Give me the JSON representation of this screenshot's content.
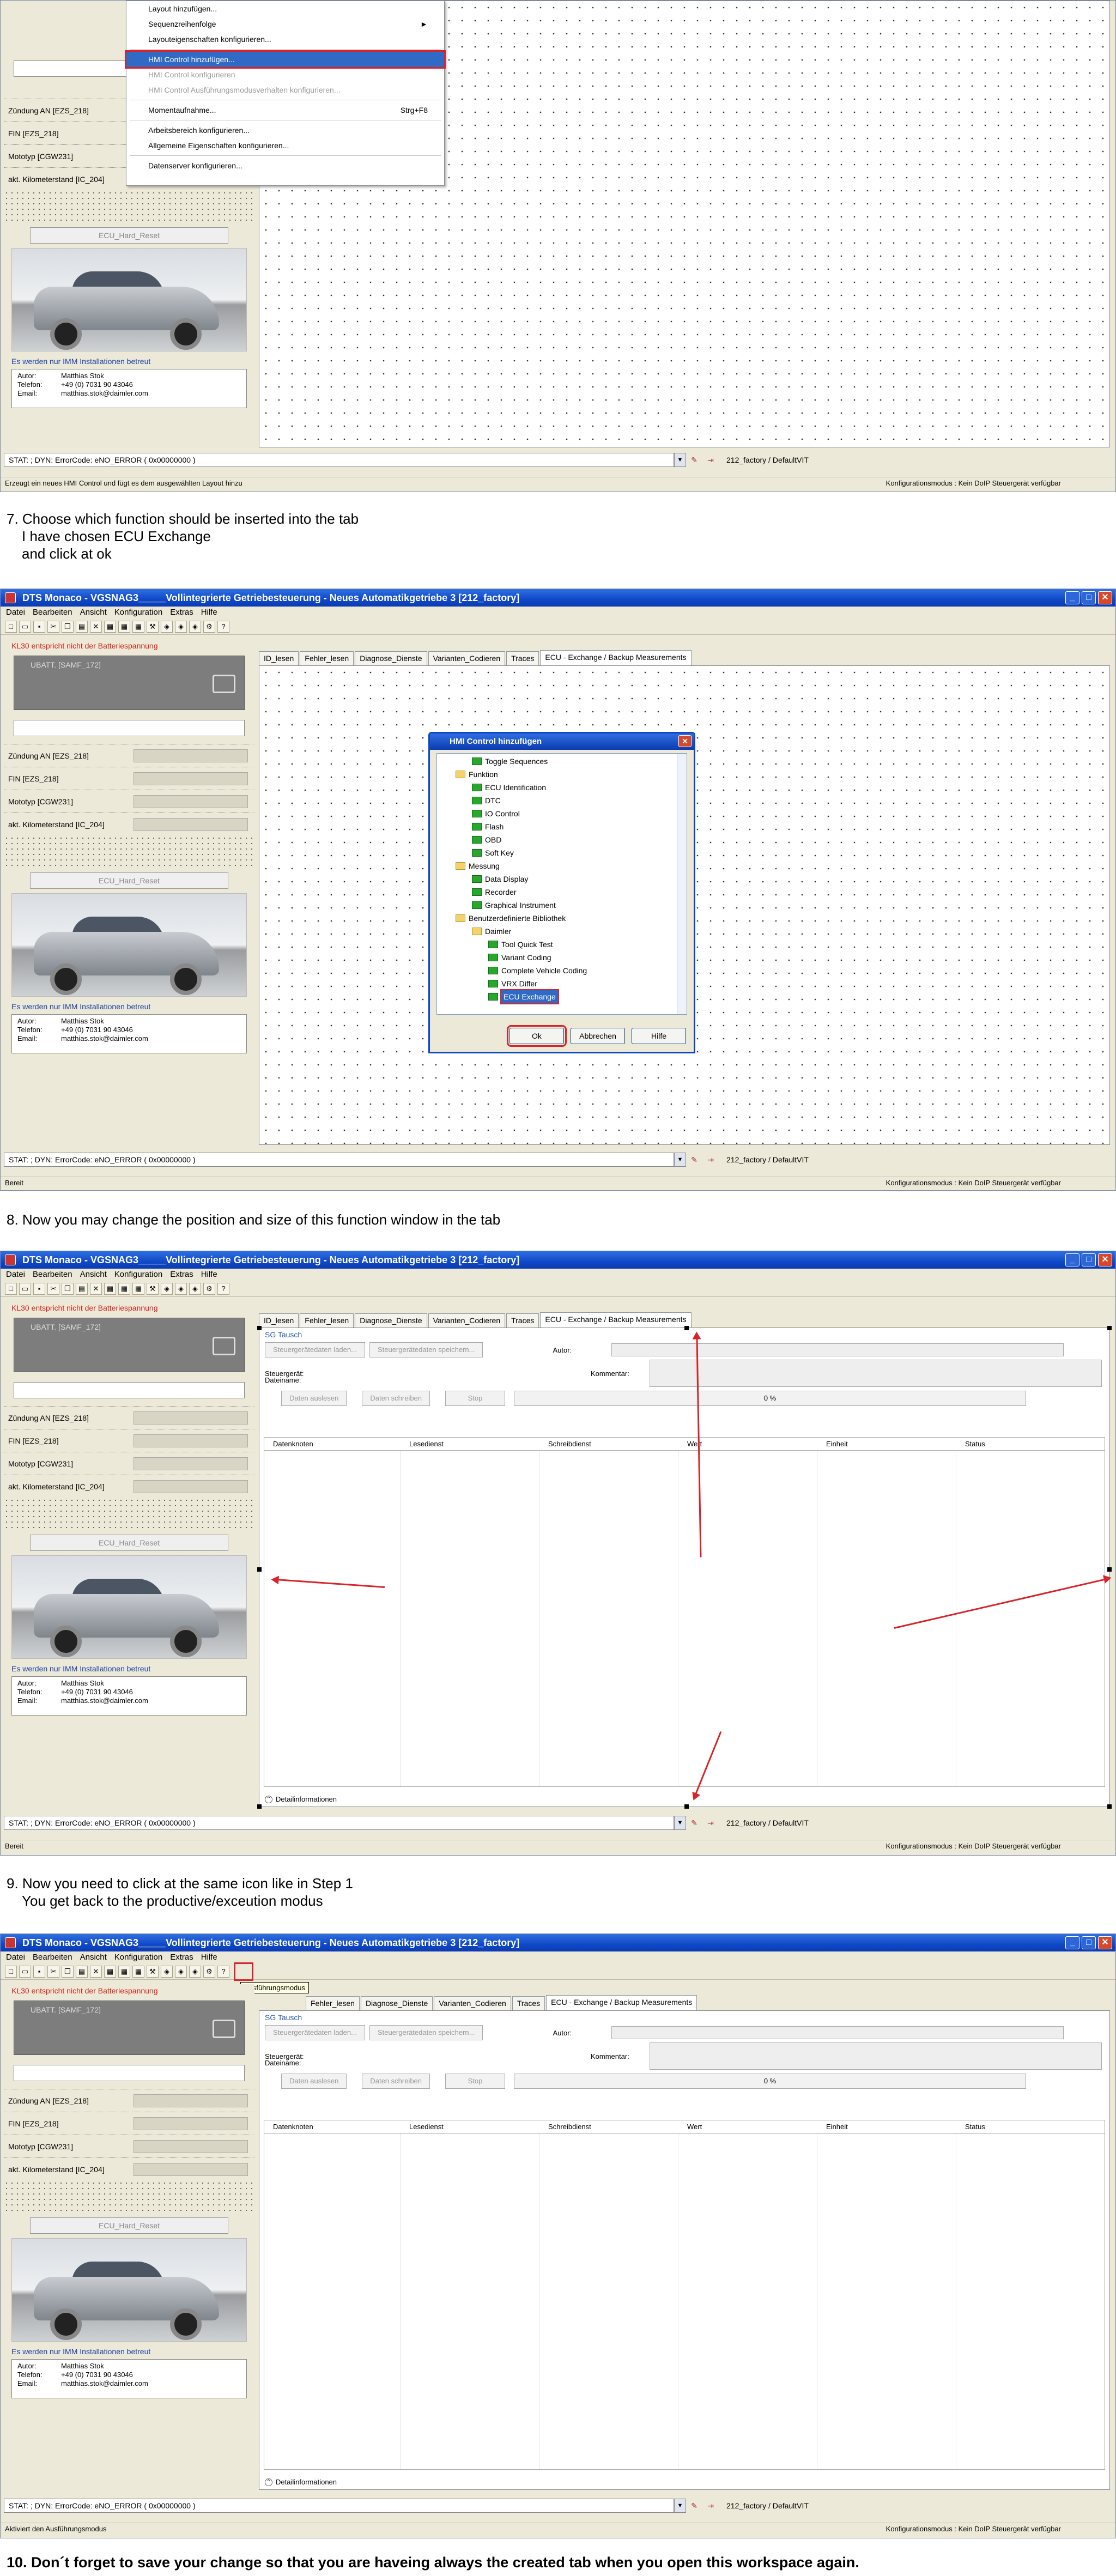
{
  "section1": {
    "menu_items": [
      {
        "label": "Layout hinzufügen...",
        "disabled": false
      },
      {
        "label": "Sequenzreihenfolge",
        "disabled": false,
        "submenu": true
      },
      {
        "label": "Layouteigenschaften konfigurieren...",
        "disabled": false
      },
      {
        "label": "HMI Control hinzufügen...",
        "disabled": false,
        "highlighted": true
      },
      {
        "label": "HMI Control konfigurieren",
        "disabled": true
      },
      {
        "label": "HMI Control Ausführungsmodusverhalten konfigurieren...",
        "disabled": true
      },
      {
        "label": "Momentaufnahme...",
        "disabled": false,
        "shortcut": "Strg+F8"
      },
      {
        "label": "Arbeitsbereich konfigurieren...",
        "disabled": false
      },
      {
        "label": "Allgemeine Eigenschaften konfigurieren...",
        "disabled": false
      },
      {
        "label": "Datenserver konfigurieren...",
        "disabled": false
      }
    ],
    "status_hint": "Erzeugt ein neues HMI Control und fügt es dem ausgewählten Layout hinzu"
  },
  "common": {
    "app_title": "DTS Monaco - VGSNAG3_____Vollintegrierte Getriebesteuerung - Neues Automatikgetriebe 3 [212_factory]",
    "menu": [
      "Datei",
      "Bearbeiten",
      "Ansicht",
      "Konfiguration",
      "Extras",
      "Hilfe"
    ],
    "tabs": [
      "ID_lesen",
      "Fehler_lesen",
      "Diagnose_Dienste",
      "Varianten_Codieren",
      "Traces",
      "ECU - Exchange / Backup Measurements"
    ],
    "warning": "KL30 entspricht nicht der Batteriespannung",
    "ubatt": "UBATT. [SAMF_172]",
    "rows": [
      "Zündung AN [EZS_218]",
      "FIN [EZS_218]",
      "Mototyp [CGW231]",
      "akt. Kilometerstand [IC_204]"
    ],
    "ecu_hard_reset": "ECU_Hard_Reset",
    "imm_note": "Es werden nur IMM Installationen betreut",
    "author": [
      {
        "k": "Autor:",
        "v": "Matthias Stok"
      },
      {
        "k": "Telefon:",
        "v": "+49 (0) 7031 90 43046"
      },
      {
        "k": "Email:",
        "v": "matthias.stok@daimler.com"
      }
    ],
    "stat": "STAT: ; DYN: ErrorCode: eNO_ERROR  ( 0x00000000 )",
    "config": "212_factory / DefaultVIT",
    "ready": "Bereit",
    "config_mode": "Konfigurationsmodus : Kein DoIP Steuergerät verfügbar"
  },
  "step7": {
    "line1": "7. Choose which function should be inserted into the tab",
    "line2": "I have chosen ECU Exchange",
    "line3": "and click at ok"
  },
  "dialog": {
    "title": "HMI Control hinzufügen",
    "tree": [
      {
        "label": "Toggle Sequences",
        "level": 2,
        "kind": "leaf"
      },
      {
        "label": "Funktion",
        "level": 1,
        "kind": "folder"
      },
      {
        "label": "ECU Identification",
        "level": 2,
        "kind": "leaf"
      },
      {
        "label": "DTC",
        "level": 2,
        "kind": "leaf"
      },
      {
        "label": "IO Control",
        "level": 2,
        "kind": "leaf"
      },
      {
        "label": "Flash",
        "level": 2,
        "kind": "leaf"
      },
      {
        "label": "OBD",
        "level": 2,
        "kind": "leaf"
      },
      {
        "label": "Soft Key",
        "level": 2,
        "kind": "leaf"
      },
      {
        "label": "Messung",
        "level": 1,
        "kind": "folder"
      },
      {
        "label": "Data Display",
        "level": 2,
        "kind": "leaf"
      },
      {
        "label": "Recorder",
        "level": 2,
        "kind": "leaf"
      },
      {
        "label": "Graphical Instrument",
        "level": 2,
        "kind": "leaf"
      },
      {
        "label": "Benutzerdefinierte Bibliothek",
        "level": 1,
        "kind": "folder"
      },
      {
        "label": "Daimler",
        "level": 2,
        "kind": "folder"
      },
      {
        "label": "Tool Quick Test",
        "level": 3,
        "kind": "leaf"
      },
      {
        "label": "Variant Coding",
        "level": 3,
        "kind": "leaf"
      },
      {
        "label": "Complete Vehicle Coding",
        "level": 3,
        "kind": "leaf"
      },
      {
        "label": "VRX Differ",
        "level": 3,
        "kind": "leaf"
      },
      {
        "label": "ECU Exchange",
        "level": 3,
        "kind": "leaf",
        "selected": true
      }
    ],
    "ok": "Ok",
    "cancel": "Abbrechen",
    "help": "Hilfe"
  },
  "step8": {
    "line1": "8. Now you may change the position and size of this function window in the tab"
  },
  "sg": {
    "title": "SG Tausch",
    "load": "Steuergerätedaten laden...",
    "save": "Steuergerätedaten speichern...",
    "author_lbl": "Autor:",
    "device_lbl": "Steuergerät:",
    "comment_lbl": "Kommentar:",
    "file_lbl": "Dateiname:",
    "read": "Daten auslesen",
    "write": "Daten schreiben",
    "stop": "Stop",
    "progress": "0 %",
    "columns": [
      "Datenknoten",
      "Lesedienst",
      "Schreibdienst",
      "Wert",
      "Einheit",
      "Status"
    ],
    "details": "Detailinformationen"
  },
  "step9": {
    "line1": "9. Now you need to click at the same icon like in Step 1",
    "line2": "You get back to the productive/exceution modus"
  },
  "tooltip": "Ausführungsmodus",
  "status_hint4": "Aktiviert den Ausführungsmodus",
  "step10": {
    "line1": "10. Don´t forget to save your change so that you are haveing always the created tab when you open this workspace again."
  }
}
